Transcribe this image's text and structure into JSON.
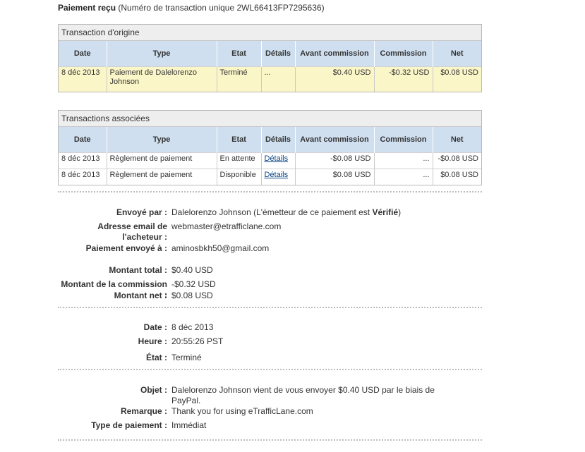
{
  "header": {
    "title": "Paiement reçu",
    "subtitle": "(Numéro de transaction unique 2WL66413FP7295636)"
  },
  "columns": [
    "Date",
    "Type",
    "Etat",
    "Détails",
    "Avant commission",
    "Commission",
    "Net"
  ],
  "original": {
    "heading": "Transaction d'origine",
    "row": {
      "date": "8 déc 2013",
      "type": "Paiement de Dalelorenzo Johnson",
      "state": "Terminé",
      "details": "...",
      "gross": "$0.40 USD",
      "fee": "-$0.32 USD",
      "net": "$0.08 USD"
    }
  },
  "related": {
    "heading": "Transactions associées",
    "rows": [
      {
        "date": "8 déc 2013",
        "type": "Règlement de paiement",
        "state": "En attente",
        "details": "Détails",
        "gross": "-$0.08 USD",
        "fee": "...",
        "net": "-$0.08 USD"
      },
      {
        "date": "8 déc 2013",
        "type": "Règlement de paiement",
        "state": "Disponible",
        "details": "Détails",
        "gross": "$0.08 USD",
        "fee": "...",
        "net": "$0.08 USD"
      }
    ]
  },
  "parties": {
    "sent_by_label": "Envoyé par :",
    "sent_by_name": "Dalelorenzo Johnson",
    "sent_by_note_pre": "(L'émetteur de ce paiement est",
    "sent_by_note_status": "Vérifié",
    "sent_by_note_post": ")",
    "buyer_email_label": "Adresse email de l'acheteur :",
    "buyer_email": "webmaster@etrafficlane.com",
    "sent_to_label": "Paiement envoyé à :",
    "sent_to": "aminosbkh50@gmail.com"
  },
  "amounts": {
    "total_label": "Montant total :",
    "total": "$0.40 USD",
    "fee_label": "Montant de la commission :",
    "fee": "-$0.32 USD",
    "net_label": "Montant net :",
    "net": "$0.08 USD"
  },
  "timing": {
    "date_label": "Date :",
    "date": "8 déc 2013",
    "time_label": "Heure :",
    "time": "20:55:26 PST",
    "state_label": "État :",
    "state": "Terminé"
  },
  "info": {
    "subject_label": "Objet :",
    "subject": "Dalelorenzo Johnson vient de vous envoyer $0.40 USD par le biais de PayPal.",
    "note_label": "Remarque :",
    "note": "Thank you for using eTrafficLane.com",
    "payment_type_label": "Type de paiement :",
    "payment_type": "Immédiat"
  },
  "colors": {
    "header_blue": "#cfdff0",
    "highlight_yellow": "#fbf6c8",
    "link_blue": "#084482"
  }
}
